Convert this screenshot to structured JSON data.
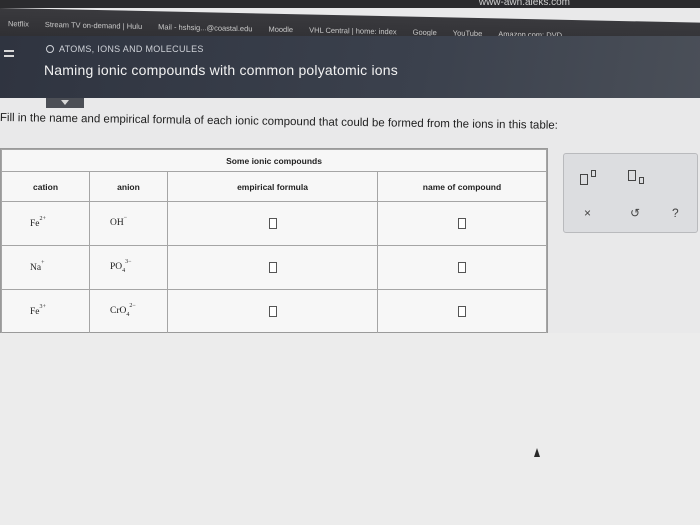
{
  "browser": {
    "url_partial": "www-awn.aleks.com",
    "bookmarks": [
      "Netflix",
      "Stream TV on-demand | Hulu",
      "Mail - hshsig...@coastal.edu",
      "Moodle",
      "VHL Central | home: index",
      "Google",
      "YouTube",
      "Amazon.com: DVD"
    ]
  },
  "header": {
    "breadcrumb": "ATOMS, IONS AND MOLECULES",
    "title": "Naming ionic compounds with common polyatomic ions"
  },
  "instruction": "Fill in the name and empirical formula of each ionic compound that could be formed from the ions in this table:",
  "table": {
    "caption": "Some ionic compounds",
    "headers": {
      "cation": "cation",
      "anion": "anion",
      "empirical": "empirical formula",
      "name": "name of compound"
    },
    "rows": [
      {
        "cation": "Fe",
        "cation_charge": "2+",
        "anion": "OH",
        "anion_sub": "",
        "anion_charge": "−"
      },
      {
        "cation": "Na",
        "cation_charge": "+",
        "anion": "PO",
        "anion_sub": "4",
        "anion_charge": "3−"
      },
      {
        "cation": "Fe",
        "cation_charge": "3+",
        "anion": "CrO",
        "anion_sub": "4",
        "anion_charge": "2−"
      }
    ]
  },
  "palette": {
    "clear_label": "×",
    "undo_label": "↺",
    "help_label": "?"
  }
}
